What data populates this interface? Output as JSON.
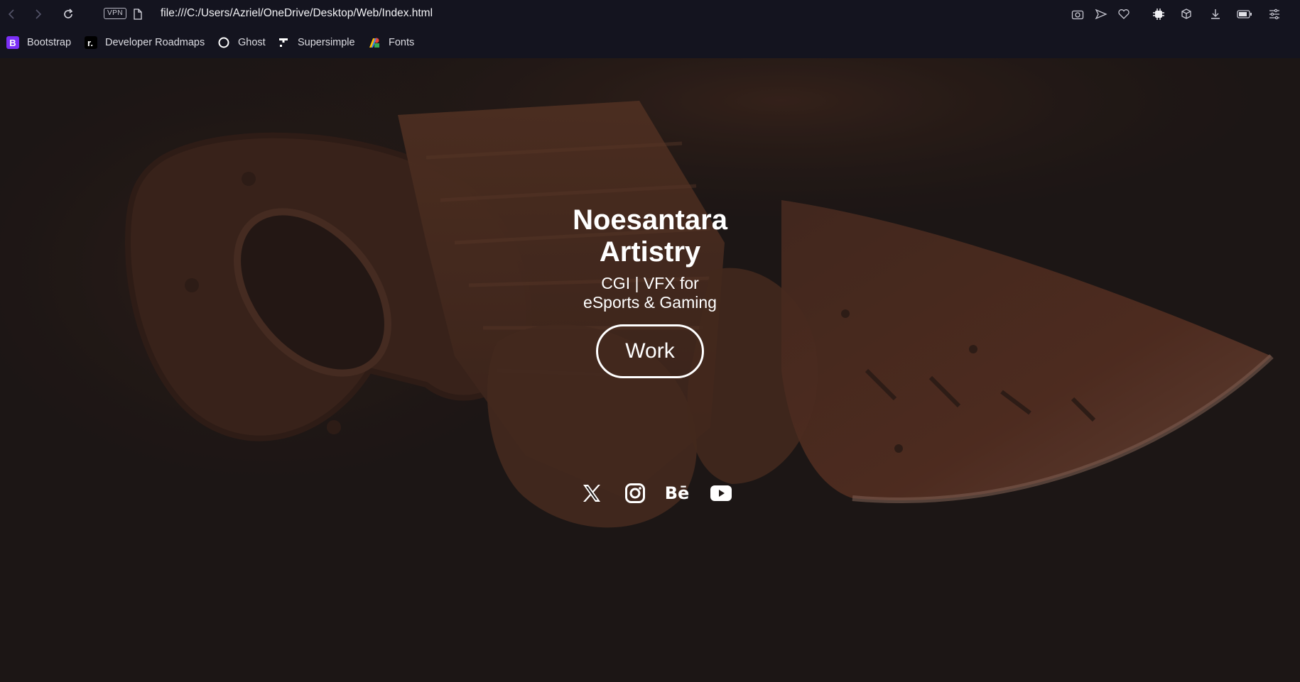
{
  "browser": {
    "url": "file:///C:/Users/Azriel/OneDrive/Desktop/Web/Index.html",
    "vpn_label": "VPN",
    "toolbar_icons": [
      "back-icon",
      "forward-icon",
      "reload-icon",
      "page-icon",
      "snapshot-icon",
      "send-icon",
      "heart-icon",
      "extension-icon",
      "cube-icon",
      "download-icon",
      "battery-icon",
      "easy-setup-icon"
    ]
  },
  "bookmarks": [
    {
      "label": "Bootstrap",
      "icon": "bootstrap-icon",
      "color": "#7b2ff7"
    },
    {
      "label": "Developer Roadmaps",
      "icon": "roadmap-icon",
      "color": "#000000"
    },
    {
      "label": "Ghost",
      "icon": "ghost-icon",
      "color": "#ffffff"
    },
    {
      "label": "Supersimple",
      "icon": "supersimple-icon",
      "color": "#ffffff"
    },
    {
      "label": "Fonts",
      "icon": "google-fonts-icon",
      "color": "#4285f4"
    }
  ],
  "hero": {
    "title": "Noesantara Artistry",
    "subtitle": "CGI | VFX for eSports & Gaming",
    "cta_label": "Work",
    "socials": [
      "x-icon",
      "instagram-icon",
      "behance-icon",
      "youtube-icon"
    ],
    "behance_glyph": "Bē"
  },
  "colors": {
    "chrome_bg": "#14141f",
    "page_overlay": "#1f1917",
    "accent_text": "#ffffff",
    "art_tone": "#8a4a2a"
  }
}
